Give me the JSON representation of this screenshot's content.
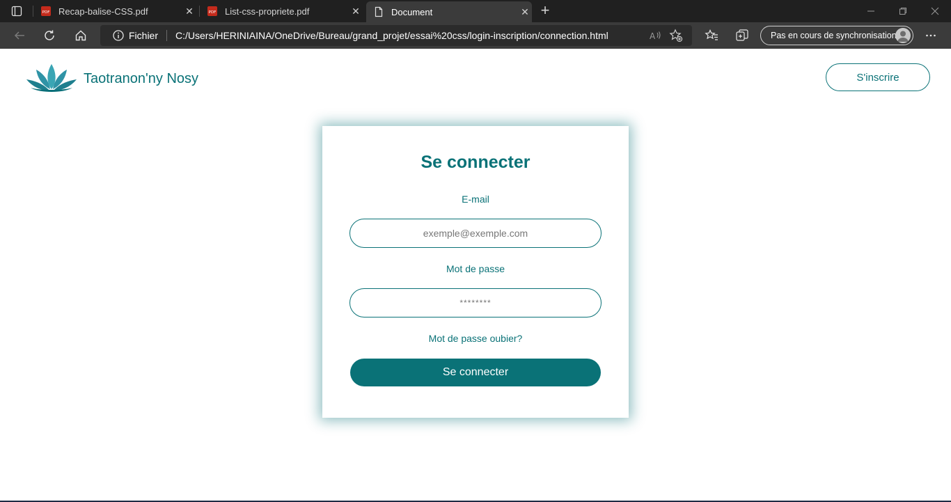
{
  "browser": {
    "tabs": [
      {
        "title": "Recap-balise-CSS.pdf",
        "icon": "pdf-icon",
        "active": false
      },
      {
        "title": "List-css-propriete.pdf",
        "icon": "pdf-icon",
        "active": false
      },
      {
        "title": "Document",
        "icon": "document-icon",
        "active": true
      }
    ],
    "close_glyph": "✕",
    "new_tab_glyph": "+",
    "address": {
      "scheme_label": "Fichier",
      "url": "C:/Users/HERINIAINA/OneDrive/Bureau/grand_projet/essai%20css/login-inscription/connection.html"
    },
    "sync_label": "Pas en cours de synchronisation"
  },
  "site": {
    "brand_name": "Taotranon'ny Nosy",
    "signup_label": "S'inscrire",
    "accent_color": "#0a7277"
  },
  "login": {
    "title": "Se connecter",
    "email_label": "E-mail",
    "email_placeholder": "exemple@exemple.com",
    "password_label": "Mot de passe",
    "password_placeholder": "********",
    "forgot_label": "Mot de passe oubier?",
    "submit_label": "Se connecter"
  }
}
